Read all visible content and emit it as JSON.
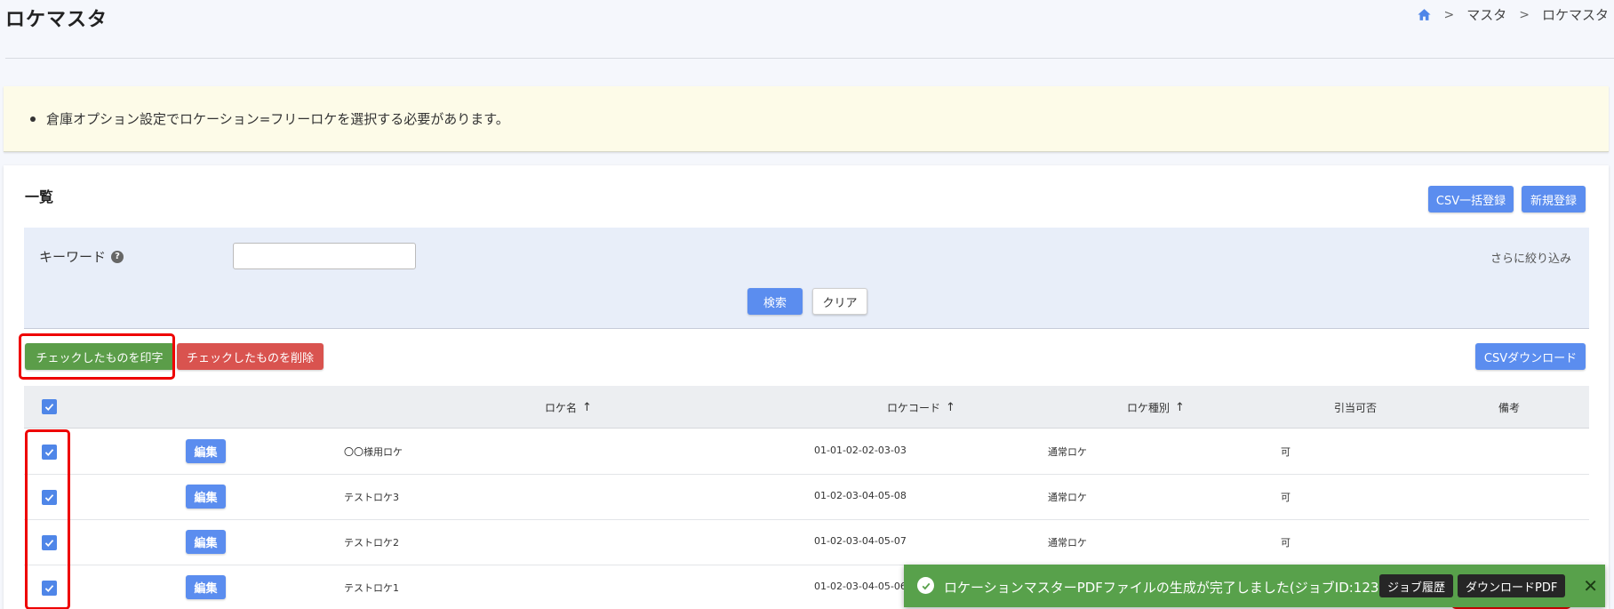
{
  "header": {
    "title": "ロケマスタ",
    "breadcrumb": [
      "マスタ",
      "ロケマスタ"
    ]
  },
  "notice": {
    "text": "倉庫オプション設定でロケーション=フリーロケを選択する必要があります。"
  },
  "list": {
    "title": "一覧",
    "csv_bulk_label": "CSV一括登録",
    "new_label": "新規登録",
    "keyword_label": "キーワード",
    "keyword_value": "",
    "more_filter_label": "さらに絞り込み",
    "search_label": "検索",
    "clear_label": "クリア",
    "print_checked_label": "チェックしたものを印字",
    "delete_checked_label": "チェックしたものを削除",
    "csv_download_label": "CSVダウンロード"
  },
  "table": {
    "headers": {
      "name": "ロケ名",
      "code": "ロケコード",
      "type": "ロケ種別",
      "allocatable": "引当可否",
      "remarks": "備考"
    },
    "edit_label": "編集",
    "rows": [
      {
        "name": "〇〇様用ロケ",
        "code": "01-01-02-02-03-03",
        "type": "通常ロケ",
        "allocatable": "可",
        "remarks": ""
      },
      {
        "name": "テストロケ3",
        "code": "01-02-03-04-05-08",
        "type": "通常ロケ",
        "allocatable": "可",
        "remarks": ""
      },
      {
        "name": "テストロケ2",
        "code": "01-02-03-04-05-07",
        "type": "通常ロケ",
        "allocatable": "可",
        "remarks": ""
      },
      {
        "name": "テストロケ1",
        "code": "01-02-03-04-05-06",
        "type": "",
        "allocatable": "",
        "remarks": ""
      }
    ]
  },
  "toast": {
    "message": "ロケーションマスターPDFファイルの生成が完了しました(ジョブID:12332)",
    "job_history_label": "ジョブ履歴",
    "download_pdf_label": "ダウンロードPDF"
  },
  "colors": {
    "accent_blue": "#5b8def",
    "print_green": "#5b9d49",
    "delete_red": "#d9534f",
    "toast_green": "#58a14b",
    "highlight_red": "#ee0000"
  }
}
